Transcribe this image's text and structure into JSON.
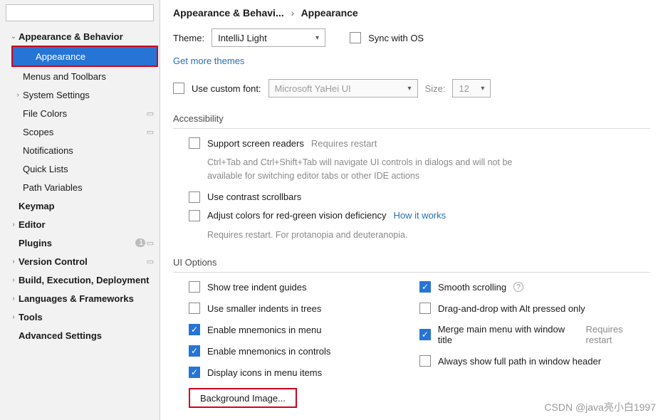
{
  "search": {
    "placeholder": ""
  },
  "sidebar": {
    "appearance_behavior": "Appearance & Behavior",
    "appearance": "Appearance",
    "menus_toolbars": "Menus and Toolbars",
    "system_settings": "System Settings",
    "file_colors": "File Colors",
    "scopes": "Scopes",
    "notifications": "Notifications",
    "quick_lists": "Quick Lists",
    "path_variables": "Path Variables",
    "keymap": "Keymap",
    "editor": "Editor",
    "plugins": "Plugins",
    "plugins_badge": "1",
    "version_control": "Version Control",
    "build": "Build, Execution, Deployment",
    "languages": "Languages & Frameworks",
    "tools": "Tools",
    "advanced": "Advanced Settings"
  },
  "breadcrumb": {
    "root": "Appearance & Behavi...",
    "leaf": "Appearance"
  },
  "theme": {
    "label": "Theme:",
    "value": "IntelliJ Light",
    "sync": "Sync with OS",
    "get_more": "Get more themes"
  },
  "custom_font": {
    "label": "Use custom font:",
    "font": "Microsoft YaHei UI",
    "size_label": "Size:",
    "size": "12"
  },
  "accessibility": {
    "title": "Accessibility",
    "screen_readers": "Support screen readers",
    "requires_restart": "Requires restart",
    "screen_hint": "Ctrl+Tab and Ctrl+Shift+Tab will navigate UI controls in dialogs and will not be available for switching editor tabs or other IDE actions",
    "contrast": "Use contrast scrollbars",
    "color_def": "Adjust colors for red-green vision deficiency",
    "how": "How it works",
    "color_hint": "Requires restart. For protanopia and deuteranopia."
  },
  "ui_options": {
    "title": "UI Options",
    "tree_guides": "Show tree indent guides",
    "smaller_indents": "Use smaller indents in trees",
    "mnemonics_menu": "Enable mnemonics in menu",
    "mnemonics_controls": "Enable mnemonics in controls",
    "display_icons": "Display icons in menu items",
    "smooth": "Smooth scrolling",
    "dnd_alt": "Drag-and-drop with Alt pressed only",
    "merge_menu": "Merge main menu with window title",
    "merge_hint": "Requires restart",
    "full_path": "Always show full path in window header",
    "bg_image": "Background Image..."
  },
  "watermark": "CSDN @java亮小白1997"
}
